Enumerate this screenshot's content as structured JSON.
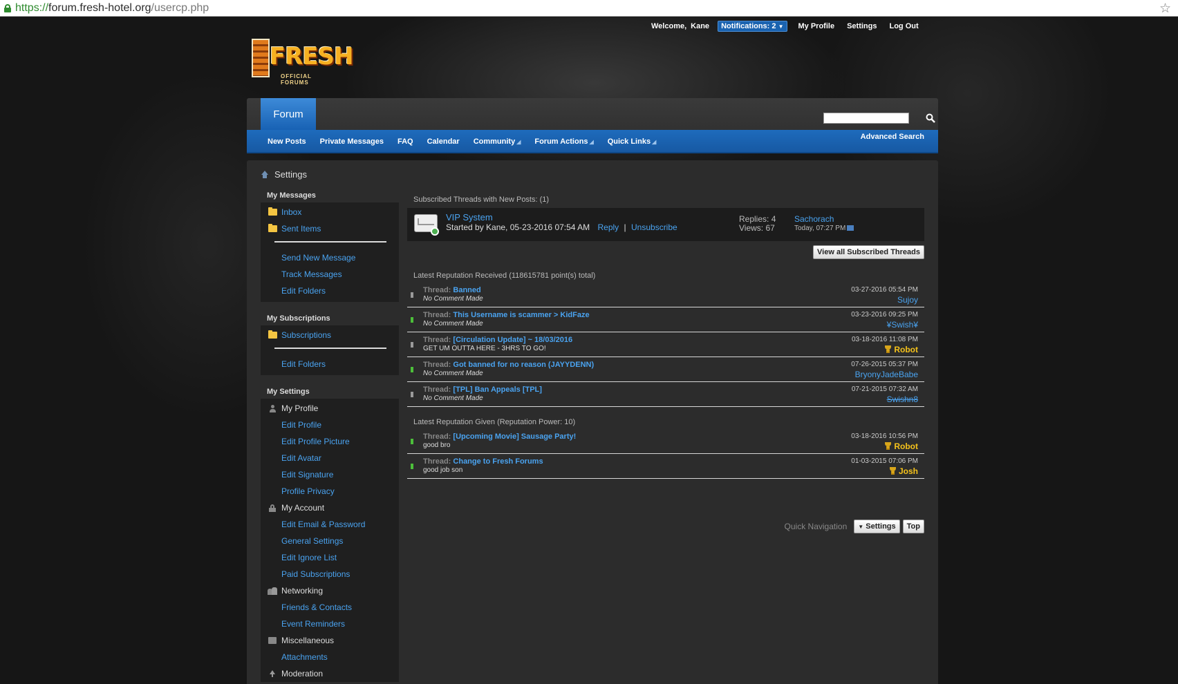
{
  "browser": {
    "url_scheme": "https://",
    "url_host": "forum.fresh-hotel.org",
    "url_path": "/usercp.php"
  },
  "userbar": {
    "welcome": "Welcome,",
    "username": "Kane",
    "notifications": "Notifications: 2",
    "my_profile": "My Profile",
    "settings": "Settings",
    "logout": "Log Out"
  },
  "logo": {
    "word": "FRESH",
    "sub": "OFFICIAL FORUMS"
  },
  "nav": {
    "tab": "Forum",
    "items": [
      "New Posts",
      "Private Messages",
      "FAQ",
      "Calendar",
      "Community",
      "Forum Actions",
      "Quick Links"
    ],
    "advanced_search": "Advanced Search",
    "search_placeholder": ""
  },
  "breadcrumb": "Settings",
  "sidebar": {
    "messages": {
      "heading": "My Messages",
      "inbox": "Inbox",
      "sent": "Sent Items",
      "send_new": "Send New Message",
      "track": "Track Messages",
      "edit_folders": "Edit Folders"
    },
    "subscriptions": {
      "heading": "My Subscriptions",
      "subscriptions": "Subscriptions",
      "edit_folders": "Edit Folders"
    },
    "settings": {
      "heading": "My Settings",
      "my_profile": "My Profile",
      "edit_profile": "Edit Profile",
      "edit_profile_picture": "Edit Profile Picture",
      "edit_avatar": "Edit Avatar",
      "edit_signature": "Edit Signature",
      "profile_privacy": "Profile Privacy",
      "my_account": "My Account",
      "edit_email_password": "Edit Email & Password",
      "general_settings": "General Settings",
      "edit_ignore_list": "Edit Ignore List",
      "paid_subscriptions": "Paid Subscriptions",
      "networking": "Networking",
      "friends_contacts": "Friends & Contacts",
      "event_reminders": "Event Reminders",
      "miscellaneous": "Miscellaneous",
      "attachments": "Attachments",
      "moderation": "Moderation"
    }
  },
  "subscribed": {
    "heading": "Subscribed Threads with New Posts: (1)",
    "thread": {
      "title": "VIP System",
      "started": "Started by Kane, 05-23-2016 07:54 AM",
      "reply": "Reply",
      "pipe": "|",
      "unsubscribe": "Unsubscribe",
      "replies": "Replies: 4",
      "views": "Views: 67",
      "last_user": "Sachorach",
      "last_time": "Today, 07:27 PM"
    },
    "view_all": "View all Subscribed Threads"
  },
  "rep_received": {
    "heading": "Latest Reputation Received (118615781 point(s) total)",
    "thread_label": "Thread:",
    "rows": [
      {
        "title": "Banned",
        "comment": "No Comment Made",
        "date": "03-27-2016 05:54 PM",
        "user": "Sujoy"
      },
      {
        "title": "This Username is scammer > KidFaze",
        "comment": "No Comment Made",
        "date": "03-23-2016 09:25 PM",
        "user": "¥Swish¥"
      },
      {
        "title": "[Circulation Update] ~ 18/03/2016",
        "comment": "GET UM OUTTA HERE - 3HRS TO GO!",
        "date": "03-18-2016 11:08 PM",
        "user": "Robot"
      },
      {
        "title": "Got banned for no reason (JAYYDENN)",
        "comment": "No Comment Made",
        "date": "07-26-2015 05:37 PM",
        "user": "BryonyJadeBabe"
      },
      {
        "title": "[TPL] Ban Appeals [TPL]",
        "comment": "No Comment Made",
        "date": "07-21-2015 07:32 AM",
        "user": "Swishn8"
      }
    ]
  },
  "rep_given": {
    "heading": "Latest Reputation Given (Reputation Power: 10)",
    "rows": [
      {
        "title": "[Upcoming Movie] Sausage Party!",
        "comment": "good bro",
        "date": "03-18-2016 10:56 PM",
        "user": "Robot"
      },
      {
        "title": "Change to Fresh Forums",
        "comment": "good job son",
        "date": "01-03-2015 07:06 PM",
        "user": "Josh"
      }
    ]
  },
  "quicknav": {
    "label": "Quick Navigation",
    "settings": "Settings",
    "top": "Top"
  },
  "colors": {
    "link": "#4aa3f0",
    "nav_blue": "#1e6bbc",
    "gold_user": "#f5c21b",
    "positive": "#4cbf3a",
    "neutral": "#9a9a9a"
  }
}
